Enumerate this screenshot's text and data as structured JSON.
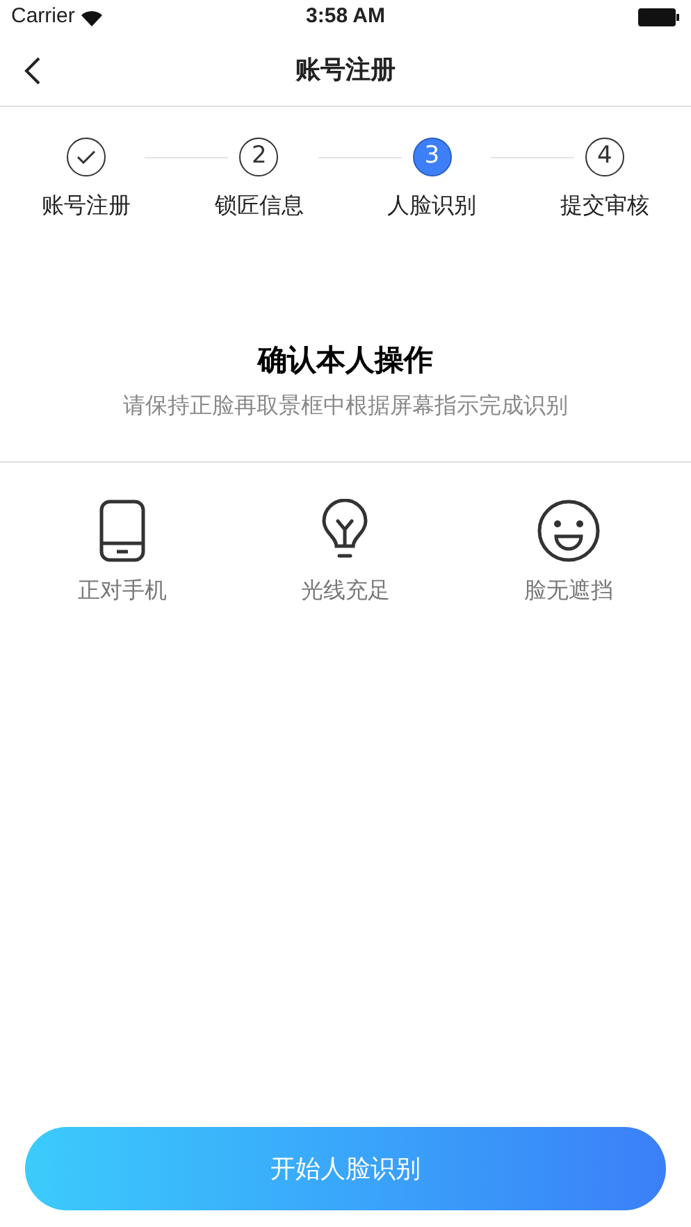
{
  "status_bar": {
    "carrier": "Carrier",
    "time": "3:58 AM"
  },
  "nav": {
    "title": "账号注册"
  },
  "steps": [
    {
      "kind": "check",
      "label": "账号注册",
      "selected": false
    },
    {
      "kind": "number",
      "number": "2",
      "label": "锁匠信息",
      "selected": false
    },
    {
      "kind": "number",
      "number": "3",
      "label": "人脸识别",
      "selected": true
    },
    {
      "kind": "number",
      "number": "4",
      "label": "提交审核",
      "selected": false
    }
  ],
  "heading": {
    "title": "确认本人操作",
    "subtitle": "请保持正脸再取景框中根据屏幕指示完成识别"
  },
  "tips": [
    {
      "kind": "phone",
      "label": "正对手机"
    },
    {
      "kind": "bulb",
      "label": "光线充足"
    },
    {
      "kind": "smile",
      "label": "脸无遮挡"
    }
  ],
  "start_button": "开始人脸识别"
}
